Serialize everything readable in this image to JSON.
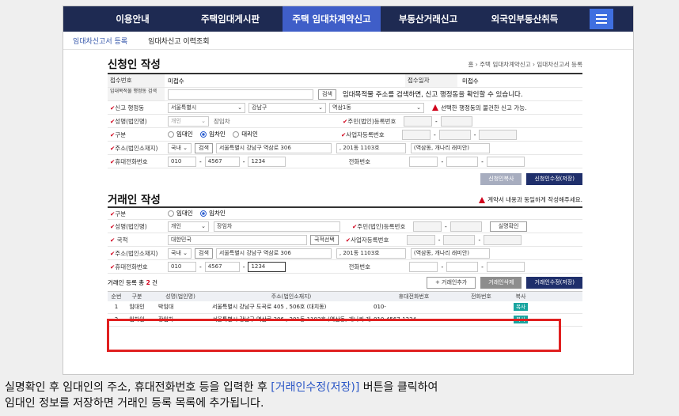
{
  "nav": {
    "items": [
      "이용안내",
      "주택임대게시판",
      "주택 임대차계약신고",
      "부동산거래신고",
      "외국인부동산취득"
    ],
    "active_index": 2
  },
  "subnav": {
    "items": [
      "임대차신고서 등록",
      "임대차신고 이력조회"
    ]
  },
  "applicant": {
    "title": "신청인 작성",
    "breadcrumb": "홈 › 주택 임대차계약신고 › 임대차신고서 등록",
    "receipt_no_label": "접수번호",
    "receipt_no_value": "미접수",
    "receipt_date_label": "접수일자",
    "receipt_date_value": "미접수",
    "address_search_label": "임대목적물 행정동 검색",
    "search_button": "검색",
    "address_notice": "임대목적물 주소를 검색하면, 신고 행정동을 확인할 수 있습니다.",
    "region_label": "신고 행정동",
    "region_sido": "서울특별시",
    "region_sigungu": "강남구",
    "region_dong": "역삼1동",
    "region_notice": "선택한 행정동의 불건한 신고 가능.",
    "name_label": "성명(법인명)",
    "name_type": "개인",
    "name_value": "장임차",
    "resident_no_label": "주민(법인)등록번호",
    "type_label": "구분",
    "type_options": [
      "임대인",
      "임차인",
      "대리인"
    ],
    "type_selected": 1,
    "biz_no_label": "사업자등록번호",
    "addr_label": "주소(법인소재지)",
    "addr_country": "국내",
    "addr_search": "검색",
    "addr_main": "서울특별시 강남구 역삼로 306",
    "addr_detail": ", 201동 1103호",
    "addr_ref": "(역삼동, 개나리 래미안)",
    "mobile_label": "휴대전화번호",
    "mobile": [
      "010",
      "4567",
      "1234"
    ],
    "phone_label": "전화번호",
    "btn_copy": "신청인복사",
    "btn_save": "신청인수정(저장)"
  },
  "broker": {
    "title": "거래인 작성",
    "agree_notice": "계약서 내용과 동일하게 작성해주세요.",
    "type_label": "구분",
    "type_options": [
      "임대인",
      "임차인"
    ],
    "type_selected": 1,
    "name_label": "성명(법인명)",
    "name_type": "개인",
    "name_value": "장임차",
    "resident_no_label": "주민(법인)등록번호",
    "verify_button": "실명확인",
    "nation_label": "국적",
    "nation_value": "대한민국",
    "nation_button": "국적선택",
    "biz_no_label": "사업자등록번호",
    "addr_label": "주소(법인소재지)",
    "addr_country": "국내",
    "addr_search": "검색",
    "addr_main": "서울특별시 강남구 역삼로 306",
    "addr_detail": ", 201동 1103호",
    "addr_ref": "(역삼동, 개나리 래미안)",
    "mobile_label": "휴대전화번호",
    "mobile": [
      "010",
      "4567",
      "1234"
    ],
    "phone_label": "전화번호",
    "count_prefix": "거래인 등록 총",
    "count_value": "2",
    "count_suffix": "건",
    "btn_add": "+ 거래인추가",
    "btn_delete": "거래인삭제",
    "btn_save": "거래인수정(저장)"
  },
  "table": {
    "headers": [
      "순번",
      "구분",
      "성명(법인명)",
      "주소(법인소재지)",
      "휴대전화번호",
      "전화번호",
      "복사"
    ],
    "rows": [
      {
        "no": "1",
        "type": "임대인",
        "name": "박임대",
        "addr": "서울특별시 강남구 도곡로 405 , 506호 (대치동)",
        "mobile": "010-",
        "phone": "",
        "copy": "복사"
      },
      {
        "no": "2",
        "type": "임차인",
        "name": "장임차",
        "addr": "서울특별시 강남구 역삼로 306 , 201동 1103호 (역삼동, 개나리 래",
        "mobile": "010-4567-1234",
        "phone": "",
        "copy": "복사"
      }
    ]
  },
  "caption": {
    "line1_a": "실명확인 후 임대인의 주소, 휴대전화번호 등을 입력한 후 ",
    "line1_link": "[거래인수정(저장)]",
    "line1_b": " 버튼을 클릭하여",
    "line2": "임대인 정보를 저장하면 거래인 등록 목록에 추가됩니다."
  },
  "colors": {
    "nav": "#1e2a52",
    "nav_active": "#3f5ec8",
    "menu_button": "#3f6fe0",
    "button_navy": "#1f2f6b",
    "button_gray": "#a7adbf",
    "copy_button": "#19a5a0",
    "highlight_border": "#e02020",
    "link": "#2a56c6"
  }
}
